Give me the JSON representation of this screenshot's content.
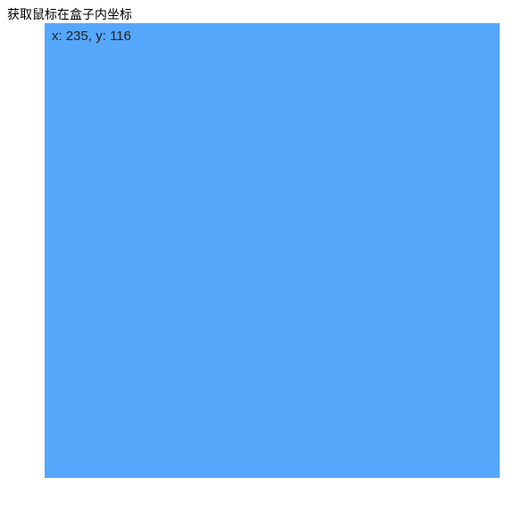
{
  "title": "获取鼠标在盒子内坐标",
  "coords": {
    "label_x": "x: ",
    "value_x": "235",
    "sep": ", ",
    "label_y": "y: ",
    "value_y": "116"
  }
}
